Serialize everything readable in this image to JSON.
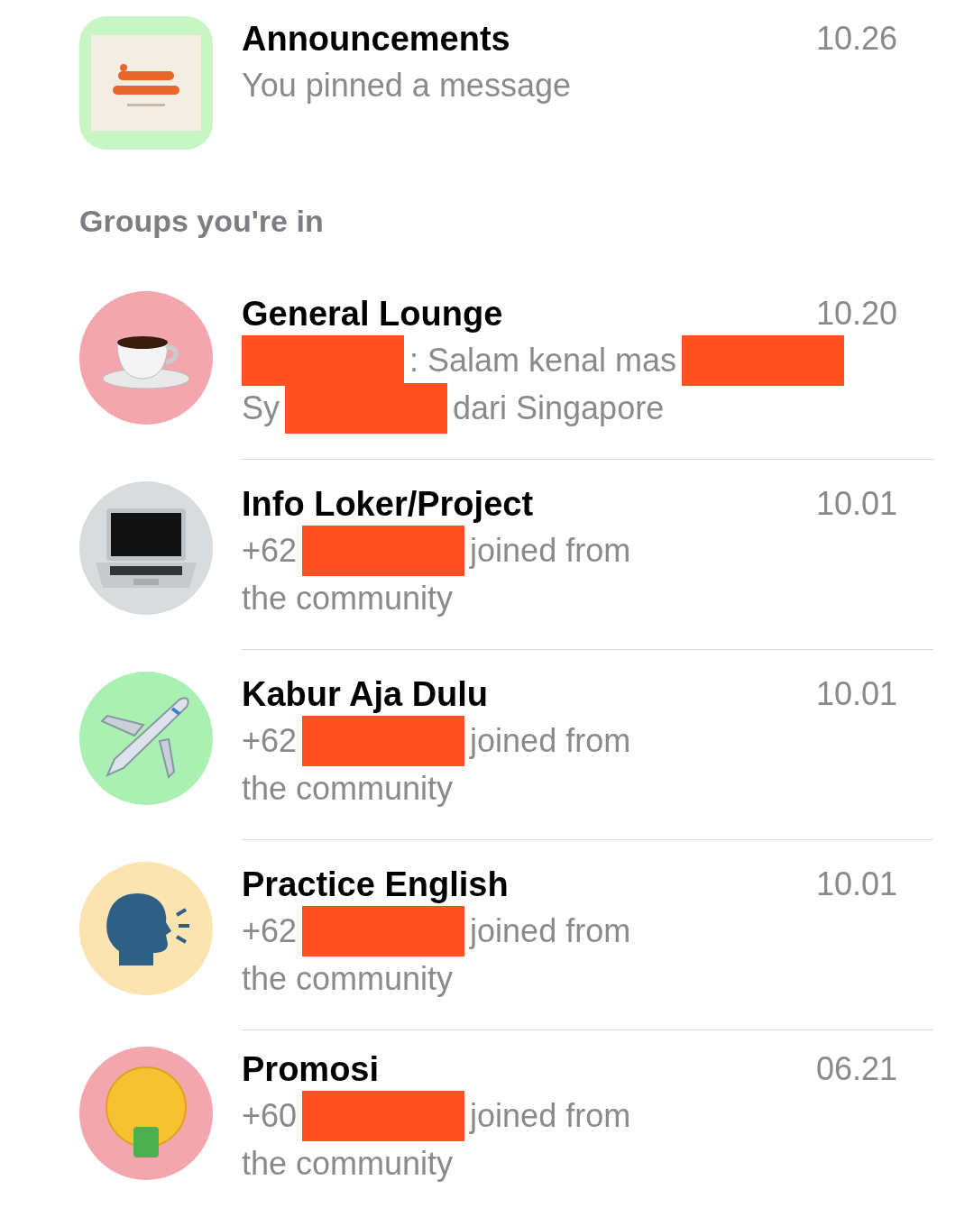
{
  "announcements": {
    "avatar": {
      "kind": "picture",
      "color": "#c8f5c4"
    },
    "name": "Announcements",
    "preview": [
      [
        {
          "kind": "text",
          "text": "You pinned a message"
        }
      ]
    ],
    "time": "10.26"
  },
  "section_title": "Groups you're in",
  "groups": [
    {
      "name": "General Lounge",
      "time": "10.20",
      "avatar": {
        "kind": "cup",
        "color": "#f4a6ae"
      },
      "preview": [
        [
          {
            "kind": "redaction"
          },
          {
            "kind": "text",
            "text": ": Salam kenal mas"
          },
          {
            "kind": "redaction"
          }
        ],
        [
          {
            "kind": "text",
            "text": "Sy"
          },
          {
            "kind": "redaction"
          },
          {
            "kind": "text",
            "text": "dari Singapore"
          }
        ]
      ]
    },
    {
      "name": "Info Loker/Project",
      "time": "10.01",
      "avatar": {
        "kind": "laptop",
        "color": "#d8dcdd"
      },
      "preview": [
        [
          {
            "kind": "text",
            "text": "+62"
          },
          {
            "kind": "redaction"
          },
          {
            "kind": "text",
            "text": "joined from"
          }
        ],
        [
          {
            "kind": "text",
            "text": "the community"
          }
        ]
      ]
    },
    {
      "name": "Kabur Aja Dulu",
      "time": "10.01",
      "avatar": {
        "kind": "plane",
        "color": "#a9f0b2"
      },
      "preview": [
        [
          {
            "kind": "text",
            "text": "+62"
          },
          {
            "kind": "redaction"
          },
          {
            "kind": "text",
            "text": "joined from"
          }
        ],
        [
          {
            "kind": "text",
            "text": "the community"
          }
        ]
      ]
    },
    {
      "name": "Practice English",
      "time": "10.01",
      "avatar": {
        "kind": "speaker",
        "color": "#fbe4b0"
      },
      "preview": [
        [
          {
            "kind": "text",
            "text": "+62"
          },
          {
            "kind": "redaction"
          },
          {
            "kind": "text",
            "text": "joined from"
          }
        ],
        [
          {
            "kind": "text",
            "text": "the community"
          }
        ]
      ]
    },
    {
      "name": "Promosi",
      "time": "06.21",
      "avatar": {
        "kind": "money",
        "color": "#f4a6ae"
      },
      "preview": [
        [
          {
            "kind": "text",
            "text": "+60"
          },
          {
            "kind": "redaction"
          },
          {
            "kind": "text",
            "text": "joined from"
          }
        ],
        [
          {
            "kind": "text",
            "text": "the community"
          }
        ]
      ]
    }
  ]
}
